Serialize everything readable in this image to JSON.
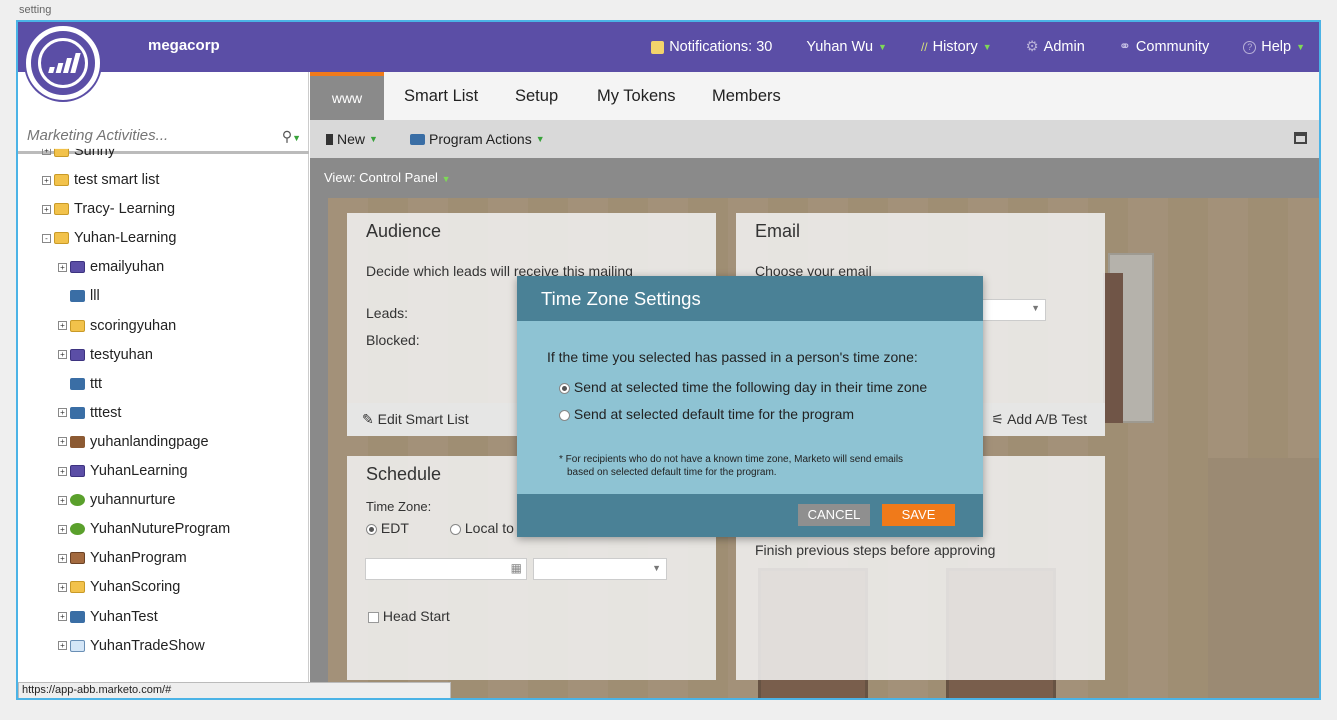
{
  "page_label": "setting",
  "header": {
    "brand": "megacorp",
    "nav": [
      {
        "label": "Notifications: 30",
        "icon": "notification-icon"
      },
      {
        "label": "Yuhan Wu",
        "icon": ""
      },
      {
        "label": "History",
        "icon": "history-icon"
      },
      {
        "label": "Admin",
        "icon": "gear-icon"
      },
      {
        "label": "Community",
        "icon": "community-icon"
      },
      {
        "label": "Help",
        "icon": "help-icon"
      }
    ]
  },
  "sidebar": {
    "search_placeholder": "Marketing Activities...",
    "items": [
      {
        "label": "Sunny",
        "icon": "folder",
        "level": 0,
        "expander": "+"
      },
      {
        "label": "test smart list",
        "icon": "folder",
        "level": 0,
        "expander": "+"
      },
      {
        "label": "Tracy- Learning",
        "icon": "folder",
        "level": 0,
        "expander": "+"
      },
      {
        "label": "Yuhan-Learning",
        "icon": "folder",
        "level": 0,
        "expander": "-"
      },
      {
        "label": "emailyuhan",
        "icon": "email",
        "level": 1,
        "expander": "+"
      },
      {
        "label": "lll",
        "icon": "test",
        "level": 1,
        "expander": ""
      },
      {
        "label": "scoringyuhan",
        "icon": "folder",
        "level": 1,
        "expander": "+"
      },
      {
        "label": "testyuhan",
        "icon": "email",
        "level": 1,
        "expander": "+"
      },
      {
        "label": "ttt",
        "icon": "test",
        "level": 1,
        "expander": ""
      },
      {
        "label": "tttest",
        "icon": "test",
        "level": 1,
        "expander": "+"
      },
      {
        "label": "yuhanlandingpage",
        "icon": "land",
        "level": 1,
        "expander": "+"
      },
      {
        "label": "YuhanLearning",
        "icon": "email",
        "level": 1,
        "expander": "+"
      },
      {
        "label": "yuhannurture",
        "icon": "nurt",
        "level": 1,
        "expander": "+"
      },
      {
        "label": "YuhanNutureProgram",
        "icon": "nurt",
        "level": 1,
        "expander": "+"
      },
      {
        "label": "YuhanProgram",
        "icon": "prog",
        "level": 1,
        "expander": "+"
      },
      {
        "label": "YuhanScoring",
        "icon": "folder",
        "level": 1,
        "expander": "+"
      },
      {
        "label": "YuhanTest",
        "icon": "test",
        "level": 1,
        "expander": "+"
      },
      {
        "label": "YuhanTradeShow",
        "icon": "event",
        "level": 1,
        "expander": "+"
      }
    ]
  },
  "status_url": "https://app-abb.marketo.com/#",
  "tabs": [
    "www",
    "Smart List",
    "Setup",
    "My Tokens",
    "Members"
  ],
  "toolbar": {
    "new_label": "New",
    "program_actions_label": "Program Actions"
  },
  "view_label": "View: Control Panel",
  "cards": {
    "audience": {
      "title": "Audience",
      "desc": "Decide which leads will receive this mailing",
      "leads": "Leads:",
      "blocked": "Blocked:",
      "edit": "Edit Smart List"
    },
    "email": {
      "title": "Email",
      "desc": "Choose your email",
      "ab": "Add A/B Test"
    },
    "schedule": {
      "title": "Schedule",
      "tz": "Time Zone:",
      "edt": "EDT",
      "local": "Local to",
      "headstart": "Head Start"
    },
    "approve": {
      "text": "Finish previous steps before approving"
    }
  },
  "modal": {
    "title": "Time Zone Settings",
    "question": "If the time you selected has passed in a person's time zone:",
    "option1": "Send at selected time the following day in their time zone",
    "option2": "Send at selected default time for the program",
    "note_line1": "* For recipients who do not have a known time zone, Marketo will send emails",
    "note_line2": "based on selected default time for the program.",
    "cancel": "CANCEL",
    "save": "SAVE"
  },
  "colors": {
    "header": "#5b4ea6",
    "accent": "#f07a1a",
    "modal_head": "#4a8196",
    "modal_body": "#8ec3d3"
  }
}
